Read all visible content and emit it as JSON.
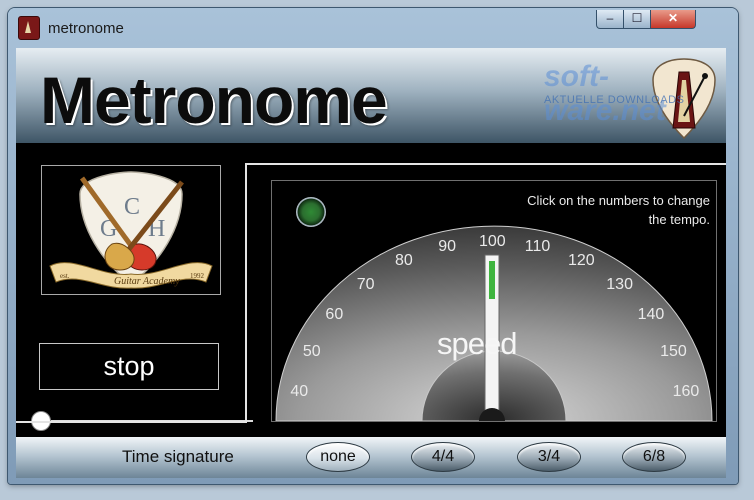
{
  "window": {
    "title": "metronome",
    "icon": "metronome-app-icon",
    "controls": {
      "minimize": "–",
      "maximize": "☐",
      "close": "✕"
    }
  },
  "banner": {
    "title": "Metronome",
    "icon": "pick-metronome-icon"
  },
  "watermark": {
    "brand": "soft-ware.net",
    "tagline": "AKTUELLE DOWNLOADS"
  },
  "logo": {
    "icon": "gch-guitar-academy-logo",
    "letters": [
      "G",
      "C",
      "H"
    ],
    "scroll_text": "Guitar Academy",
    "est": "est.",
    "year": "1992"
  },
  "transport": {
    "button_label": "stop"
  },
  "volume_slider": {
    "value": 0
  },
  "dial": {
    "hint": "Click on the numbers to change the tempo.",
    "center_label": "speed",
    "tempo_marks": [
      "40",
      "50",
      "60",
      "70",
      "80",
      "90",
      "100",
      "110",
      "120",
      "130",
      "140",
      "150",
      "160"
    ],
    "current_tempo": 100,
    "beat_led_color": "#2f8a35",
    "needle_color": "#3fb53f"
  },
  "time_signature": {
    "label": "Time signature",
    "options": [
      "none",
      "4/4",
      "3/4",
      "6/8"
    ],
    "selected": "none"
  }
}
